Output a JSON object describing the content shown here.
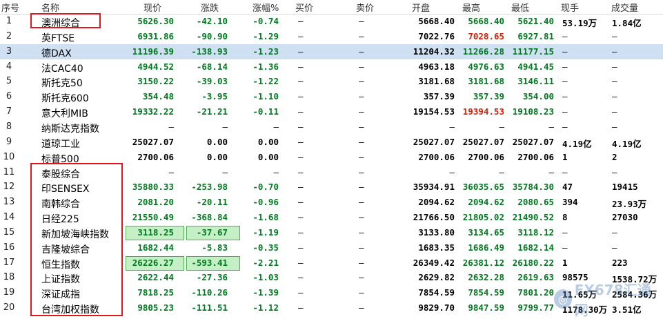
{
  "headers": [
    "序号",
    "名称",
    "现价",
    "涨跌",
    "涨幅%",
    "买价",
    "卖价",
    "开盘",
    "最高",
    "最低",
    "现手",
    "成交量"
  ],
  "rows": [
    {
      "idx": "1",
      "name": "澳洲综合",
      "price": "5626.30",
      "chg": "-42.10",
      "pct": "-0.74",
      "bid": "—",
      "ask": "—",
      "open": "5668.40",
      "high": "5668.40",
      "low": "5621.40",
      "hand": "53.19万",
      "vol": "1.84亿"
    },
    {
      "idx": "2",
      "name": "英FTSE",
      "price": "6931.86",
      "chg": "-90.90",
      "pct": "-1.29",
      "bid": "—",
      "ask": "—",
      "open": "7022.76",
      "high": "7028.65",
      "low": "6927.81",
      "hand": "—",
      "vol": "—"
    },
    {
      "idx": "3",
      "name": "德DAX",
      "price": "11196.39",
      "chg": "-138.93",
      "pct": "-1.23",
      "bid": "—",
      "ask": "—",
      "open": "11204.32",
      "high": "11266.28",
      "low": "11177.15",
      "hand": "—",
      "vol": "—"
    },
    {
      "idx": "4",
      "name": "法CAC40",
      "price": "4944.52",
      "chg": "-68.14",
      "pct": "-1.36",
      "bid": "—",
      "ask": "—",
      "open": "4963.18",
      "high": "4976.63",
      "low": "4941.45",
      "hand": "—",
      "vol": "—"
    },
    {
      "idx": "5",
      "name": "斯托克50",
      "price": "3150.22",
      "chg": "-39.03",
      "pct": "-1.22",
      "bid": "—",
      "ask": "—",
      "open": "3181.68",
      "high": "3181.68",
      "low": "3146.11",
      "hand": "—",
      "vol": "—"
    },
    {
      "idx": "6",
      "name": "斯托克600",
      "price": "354.48",
      "chg": "-3.95",
      "pct": "-1.10",
      "bid": "—",
      "ask": "—",
      "open": "357.39",
      "high": "357.39",
      "low": "354.00",
      "hand": "—",
      "vol": "—"
    },
    {
      "idx": "7",
      "name": "意大利MIB",
      "price": "19332.22",
      "chg": "-21.21",
      "pct": "-0.11",
      "bid": "—",
      "ask": "—",
      "open": "19154.53",
      "high": "19394.53",
      "low": "19108.23",
      "hand": "—",
      "vol": "—"
    },
    {
      "idx": "8",
      "name": "纳斯达克指数",
      "price": "—",
      "chg": "—",
      "pct": "—",
      "bid": "—",
      "ask": "—",
      "open": "—",
      "high": "—",
      "low": "—",
      "hand": "—",
      "vol": "—"
    },
    {
      "idx": "9",
      "name": "道琼工业",
      "price": "25027.07",
      "chg": "0.00",
      "pct": "0.00",
      "bid": "—",
      "ask": "—",
      "open": "25027.07",
      "high": "25027.07",
      "low": "25027.07",
      "hand": "4.19亿",
      "vol": "4.19亿"
    },
    {
      "idx": "10",
      "name": "标普500",
      "price": "2700.06",
      "chg": "0.00",
      "pct": "0.00",
      "bid": "—",
      "ask": "—",
      "open": "2700.06",
      "high": "2700.06",
      "low": "2700.06",
      "hand": "1",
      "vol": "2"
    },
    {
      "idx": "11",
      "name": "泰股综合",
      "price": "—",
      "chg": "—",
      "pct": "—",
      "bid": "—",
      "ask": "—",
      "open": "—",
      "high": "—",
      "low": "—",
      "hand": "—",
      "vol": "—"
    },
    {
      "idx": "12",
      "name": "印SENSEX",
      "price": "35880.33",
      "chg": "-253.98",
      "pct": "-0.70",
      "bid": "—",
      "ask": "—",
      "open": "35934.91",
      "high": "36035.65",
      "low": "35784.30",
      "hand": "47",
      "vol": "19415"
    },
    {
      "idx": "13",
      "name": "南韩综合",
      "price": "2081.20",
      "chg": "-20.11",
      "pct": "-0.96",
      "bid": "—",
      "ask": "—",
      "open": "2094.62",
      "high": "2094.62",
      "low": "2080.65",
      "hand": "394",
      "vol": "23.93万"
    },
    {
      "idx": "14",
      "name": "日经225",
      "price": "21550.49",
      "chg": "-368.84",
      "pct": "-1.68",
      "bid": "—",
      "ask": "—",
      "open": "21766.50",
      "high": "21805.02",
      "low": "21490.52",
      "hand": "8",
      "vol": "27030"
    },
    {
      "idx": "15",
      "name": "新加坡海峡指数",
      "price": "3118.25",
      "chg": "-37.67",
      "pct": "-1.19",
      "bid": "—",
      "ask": "—",
      "open": "3133.80",
      "high": "3134.65",
      "low": "3118.12",
      "hand": "—",
      "vol": "—"
    },
    {
      "idx": "16",
      "name": "吉隆坡综合",
      "price": "1682.44",
      "chg": "-5.83",
      "pct": "-0.35",
      "bid": "—",
      "ask": "—",
      "open": "1683.35",
      "high": "1686.49",
      "low": "1682.14",
      "hand": "—",
      "vol": "—"
    },
    {
      "idx": "17",
      "name": "恒生指数",
      "price": "26226.27",
      "chg": "-593.41",
      "pct": "-2.21",
      "bid": "—",
      "ask": "—",
      "open": "26349.42",
      "high": "26381.12",
      "low": "26180.22",
      "hand": "1",
      "vol": "223"
    },
    {
      "idx": "18",
      "name": "上证指数",
      "price": "2622.44",
      "chg": "-27.36",
      "pct": "-1.03",
      "bid": "—",
      "ask": "—",
      "open": "2629.82",
      "high": "2632.28",
      "low": "2619.63",
      "hand": "98575",
      "vol": "1538.72万"
    },
    {
      "idx": "19",
      "name": "深证成指",
      "price": "7818.25",
      "chg": "-110.26",
      "pct": "-1.39",
      "bid": "—",
      "ask": "—",
      "open": "7854.59",
      "high": "7854.59",
      "low": "7801.20",
      "hand": "11.65万",
      "vol": "2584.36万"
    },
    {
      "idx": "20",
      "name": "台湾加权指数",
      "price": "9805.23",
      "chg": "-111.51",
      "pct": "-1.12",
      "bid": "—",
      "ask": "—",
      "open": "9829.70",
      "high": "9847.59",
      "low": "9799.77",
      "hand": "1178.30万",
      "vol": "3.51亿"
    }
  ],
  "colors": {
    "down": "#007a1f",
    "up": "#d81e06",
    "selected_row_bg": "#cfe0f3",
    "annotation": "#e0161b"
  },
  "watermark": {
    "text": "FX678汇通网"
  }
}
